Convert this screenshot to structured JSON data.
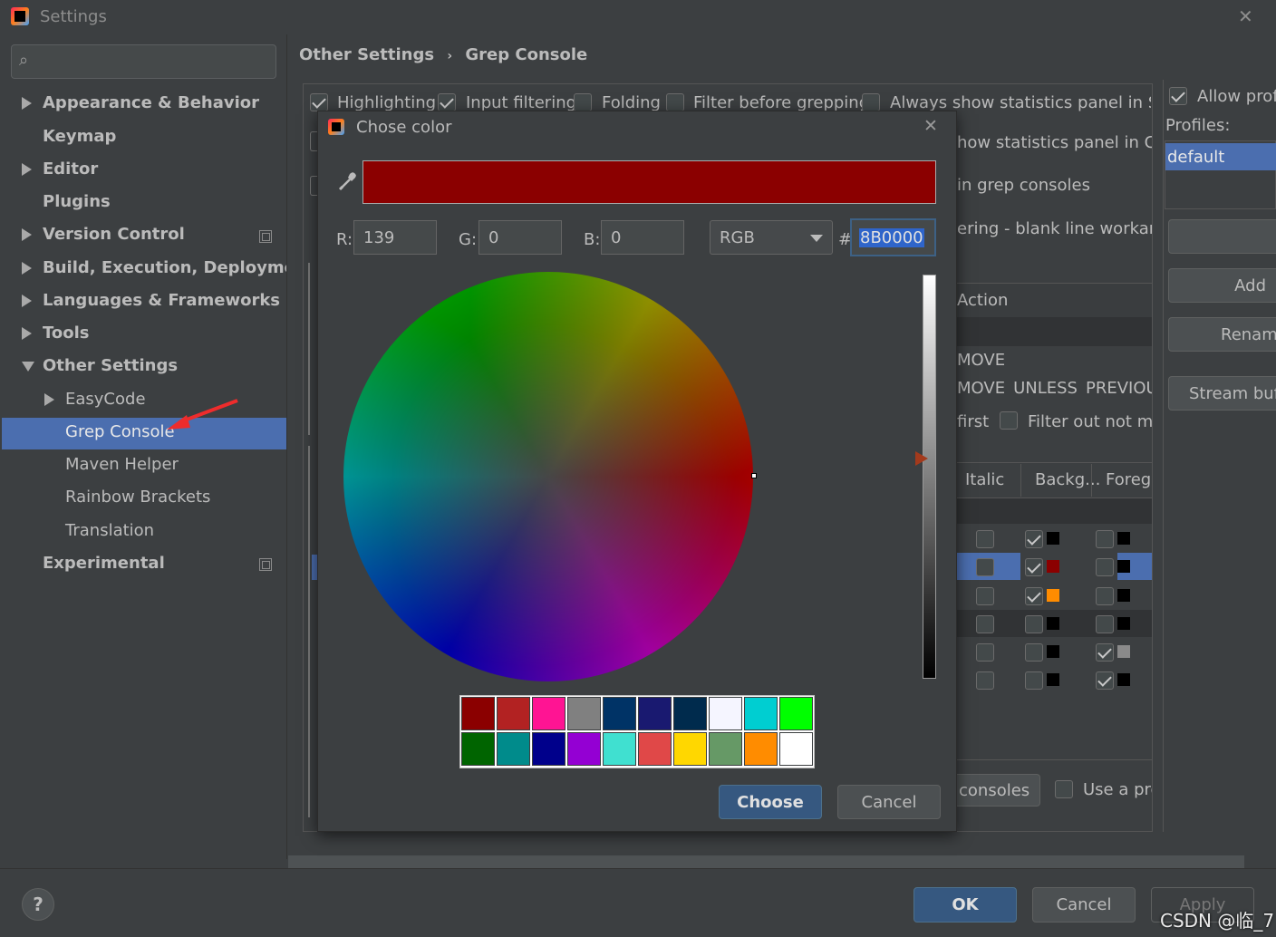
{
  "window": {
    "title": "Settings"
  },
  "search": {
    "placeholder": ""
  },
  "sidebar": {
    "items": [
      {
        "label": "Appearance & Behavior"
      },
      {
        "label": "Keymap"
      },
      {
        "label": "Editor"
      },
      {
        "label": "Plugins"
      },
      {
        "label": "Version Control"
      },
      {
        "label": "Build, Execution, Deployment"
      },
      {
        "label": "Languages & Frameworks"
      },
      {
        "label": "Tools"
      },
      {
        "label": "Other Settings"
      },
      {
        "label": "EasyCode"
      },
      {
        "label": "Grep Console"
      },
      {
        "label": "Maven Helper"
      },
      {
        "label": "Rainbow Brackets"
      },
      {
        "label": "Translation"
      },
      {
        "label": "Experimental"
      }
    ]
  },
  "breadcrumb": {
    "parent": "Other Settings",
    "separator": "›",
    "current": "Grep Console"
  },
  "options": {
    "highlighting": "Highlighting",
    "input_filtering": "Input filtering",
    "folding": "Folding",
    "filter_before": "Filter before grepping",
    "always_show": "Always show statistics panel in Statu",
    "show_cons": "how statistics panel in Cons",
    "grep_consoles": "in grep consoles",
    "blank_line": "ering - blank line workarou",
    "action_header": "Action",
    "move": "MOVE",
    "move_unless": "MOVE_UNLESS_PREVIOUS",
    "first": "first",
    "filter_out": "Filter out not mat",
    "col_italic": "Italic",
    "col_background": "Backg...",
    "col_foreground": "Foreg...",
    "consoles": "consoles",
    "use_pre": "Use a pre"
  },
  "profiles": {
    "allow": "Allow prof",
    "label": "Profiles:",
    "items": [
      "default"
    ],
    "add_button": "Add",
    "rename_button": "Rename",
    "stream_button": "Stream buff"
  },
  "dialog": {
    "title": "Chose color",
    "color_hex": "#8b0000",
    "r_label": "R:",
    "r_value": "139",
    "g_label": "G:",
    "g_value": "0",
    "b_label": "B:",
    "b_value": "0",
    "mode": "RGB",
    "hash": "#",
    "hex_value": "8B0000",
    "choose_button": "Choose",
    "cancel_button": "Cancel",
    "swatches": [
      "#8b0000",
      "#b22222",
      "#ff1493",
      "#808080",
      "#003366",
      "#191970",
      "#002b4d",
      "#f5f5ff",
      "#00ced1",
      "#00ff00",
      "#006400",
      "#008b8b",
      "#00008b",
      "#9400d3",
      "#40e0d0",
      "#e04848",
      "#ffd700",
      "#669966",
      "#ff8c00",
      "#ffffff"
    ]
  },
  "footer": {
    "help": "?",
    "ok_button": "OK",
    "cancel_button": "Cancel",
    "apply_button": "Apply"
  },
  "watermark": "CSDN @临_7"
}
